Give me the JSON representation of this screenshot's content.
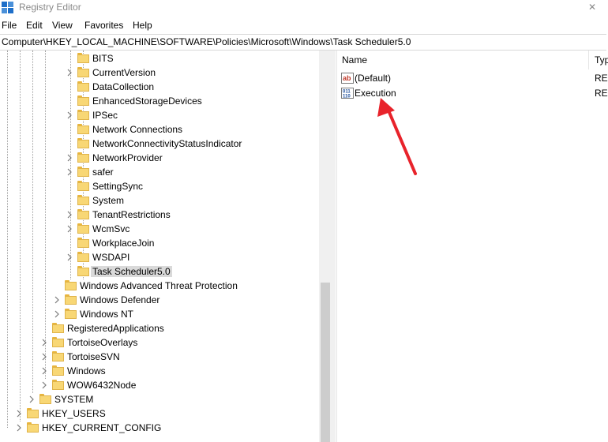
{
  "window": {
    "title": "Registry Editor",
    "close_glyph": "✕"
  },
  "menu": [
    "File",
    "Edit",
    "View",
    "Favorites",
    "Help"
  ],
  "address": "Computer\\HKEY_LOCAL_MACHINE\\SOFTWARE\\Policies\\Microsoft\\Windows\\Task Scheduler5.0",
  "tree": {
    "nodes": [
      {
        "label": "BITS",
        "expandable": false,
        "level": 4
      },
      {
        "label": "CurrentVersion",
        "expandable": true,
        "level": 4
      },
      {
        "label": "DataCollection",
        "expandable": false,
        "level": 4
      },
      {
        "label": "EnhancedStorageDevices",
        "expandable": false,
        "level": 4
      },
      {
        "label": "IPSec",
        "expandable": true,
        "level": 4
      },
      {
        "label": "Network Connections",
        "expandable": false,
        "level": 4
      },
      {
        "label": "NetworkConnectivityStatusIndicator",
        "expandable": false,
        "level": 4
      },
      {
        "label": "NetworkProvider",
        "expandable": true,
        "level": 4
      },
      {
        "label": "safer",
        "expandable": true,
        "level": 4
      },
      {
        "label": "SettingSync",
        "expandable": false,
        "level": 4
      },
      {
        "label": "System",
        "expandable": false,
        "level": 4
      },
      {
        "label": "TenantRestrictions",
        "expandable": true,
        "level": 4
      },
      {
        "label": "WcmSvc",
        "expandable": true,
        "level": 4
      },
      {
        "label": "WorkplaceJoin",
        "expandable": false,
        "level": 4
      },
      {
        "label": "WSDAPI",
        "expandable": true,
        "level": 4
      },
      {
        "label": "Task Scheduler5.0",
        "expandable": false,
        "level": 4,
        "selected": true
      },
      {
        "label": "Windows Advanced Threat Protection",
        "expandable": false,
        "level": 3
      },
      {
        "label": "Windows Defender",
        "expandable": true,
        "level": 3
      },
      {
        "label": "Windows NT",
        "expandable": true,
        "level": 3
      },
      {
        "label": "RegisteredApplications",
        "expandable": false,
        "level": 2
      },
      {
        "label": "TortoiseOverlays",
        "expandable": true,
        "level": 2
      },
      {
        "label": "TortoiseSVN",
        "expandable": true,
        "level": 2
      },
      {
        "label": "Windows",
        "expandable": true,
        "level": 2
      },
      {
        "label": "WOW6432Node",
        "expandable": true,
        "level": 2
      },
      {
        "label": "SYSTEM",
        "expandable": true,
        "level": 1
      },
      {
        "label": "HKEY_USERS",
        "expandable": true,
        "level": 0
      },
      {
        "label": "HKEY_CURRENT_CONFIG",
        "expandable": true,
        "level": 0
      }
    ]
  },
  "values_pane": {
    "columns": [
      "Name",
      "Typ"
    ],
    "rows": [
      {
        "name": "(Default)",
        "type": "REG",
        "icon": "string-value-icon"
      },
      {
        "name": "Execution",
        "type": "REG",
        "icon": "binary-value-icon"
      }
    ]
  },
  "annotation": {
    "arrow_color": "#e8232b"
  }
}
